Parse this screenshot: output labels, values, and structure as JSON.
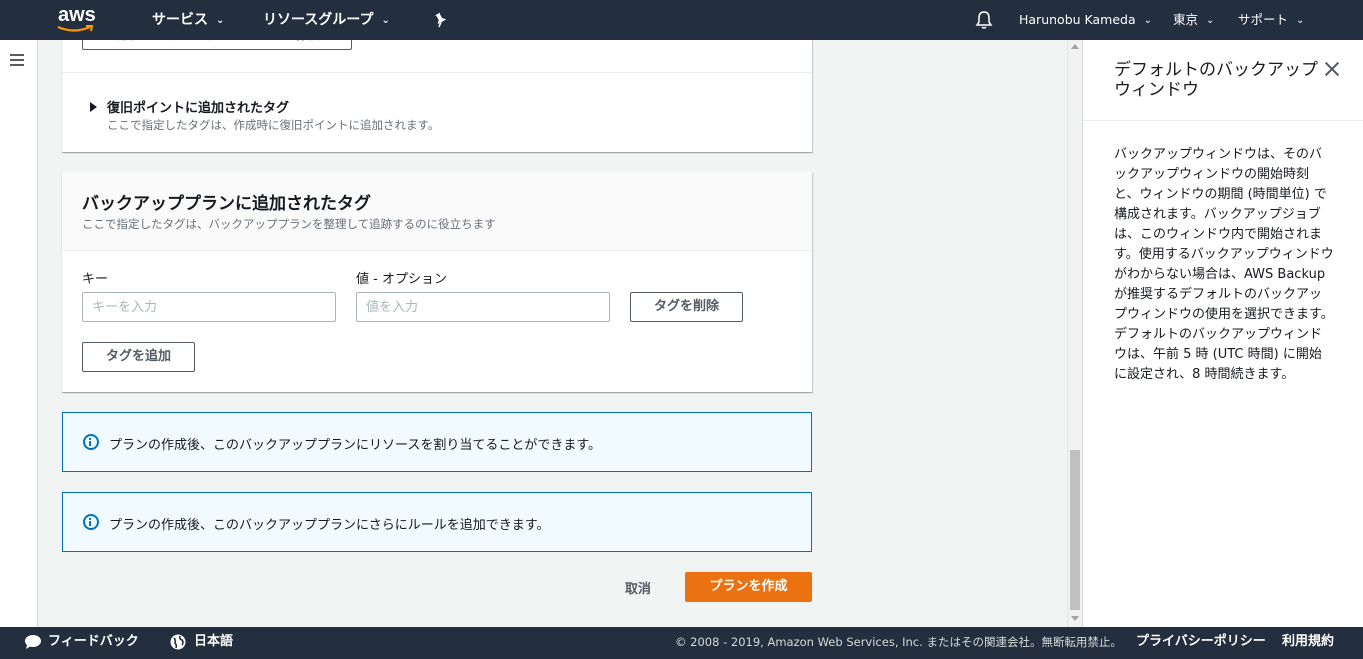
{
  "nav": {
    "brand": "aws",
    "services": "サービス",
    "resource_groups": "リソースグループ",
    "user": "Harunobu Kameda",
    "region": "東京",
    "support": "サポート"
  },
  "expander": {
    "cut_button": "新しいバックアップボールトを作成",
    "title": "復旧ポイントに追加されたタグ",
    "desc": "ここで指定したタグは、作成時に復旧ポイントに追加されます。"
  },
  "tags_panel": {
    "title": "バックアッププランに追加されたタグ",
    "desc": "ここで指定したタグは、バックアッププランを整理して追跡するのに役立ちます",
    "key_label": "キー",
    "key_placeholder": "キーを入力",
    "value_label": "値 - オプション",
    "value_placeholder": "値を入力",
    "remove_tag": "タグを削除",
    "add_tag": "タグを追加"
  },
  "info": {
    "box1": "プランの作成後、このバックアッププランにリソースを割り当てることができます。",
    "box2": "プランの作成後、このバックアッププランにさらにルールを追加できます。"
  },
  "actions": {
    "cancel": "取消",
    "create": "プランを作成"
  },
  "help": {
    "title": "デフォルトのバックアップウィンドウ",
    "body": "バックアップウィンドウは、そのバックアップウィンドウの開始時刻と、ウィンドウの期間 (時間単位) で構成されます。バックアップジョブは、このウィンドウ内で開始されます。使用するバックアップウィンドウがわからない場合は、AWS Backup が推奨するデフォルトのバックアップウィンドウの使用を選択できます。デフォルトのバックアップウィンドウは、午前 5 時 (UTC 時間) に開始に設定され、8 時間続きます。"
  },
  "footer": {
    "feedback": "フィードバック",
    "language": "日本語",
    "copyright": "© 2008 - 2019, Amazon Web Services, Inc. またはその関連会社。無断転用禁止。",
    "privacy": "プライバシーポリシー",
    "terms": "利用規約"
  },
  "colors": {
    "nav_bg": "#232f3e",
    "primary": "#ec7211",
    "info_border": "#0073bb",
    "info_bg": "#f1faff"
  },
  "icons": [
    "hamburger-icon",
    "pin-icon",
    "bell-icon",
    "info-icon",
    "close-icon",
    "speech-bubble-icon",
    "globe-icon",
    "chevron-down-icon",
    "expand-triangle-icon"
  ]
}
